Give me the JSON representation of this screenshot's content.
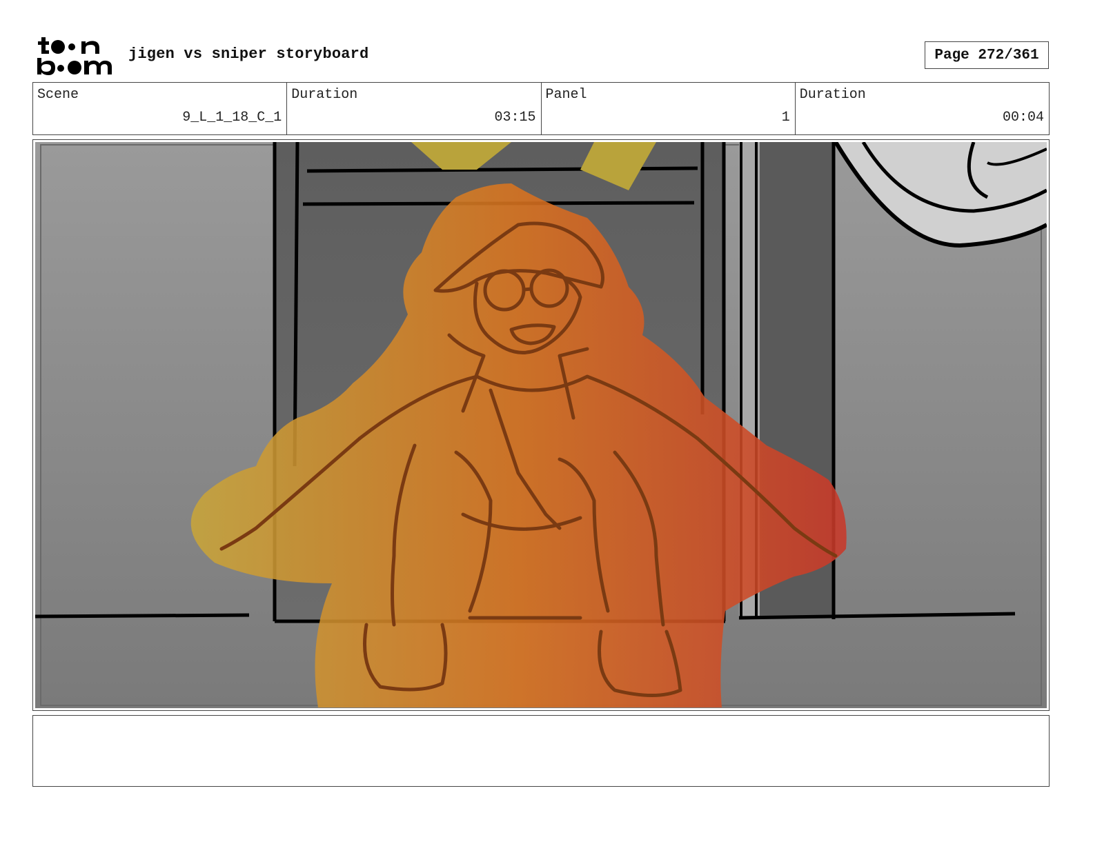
{
  "header": {
    "logo_text_top": "toon",
    "logo_text_bottom": "boom",
    "title": "jigen vs sniper storyboard",
    "page_label": "Page",
    "page_value": "272/361"
  },
  "info": {
    "scene_label": "Scene",
    "scene_value": "9_L_1_18_C_1",
    "duration_label": "Duration",
    "duration_value": "03:15",
    "panel_label": "Panel",
    "panel_value": "1",
    "panel_duration_label": "Duration",
    "panel_duration_value": "00:04"
  },
  "notes": {
    "text": ""
  },
  "colors": {
    "aura_yellow": "#c8a53a",
    "aura_orange": "#d9731f",
    "aura_red": "#c8382a",
    "background_gray": "#8a8a8a"
  }
}
